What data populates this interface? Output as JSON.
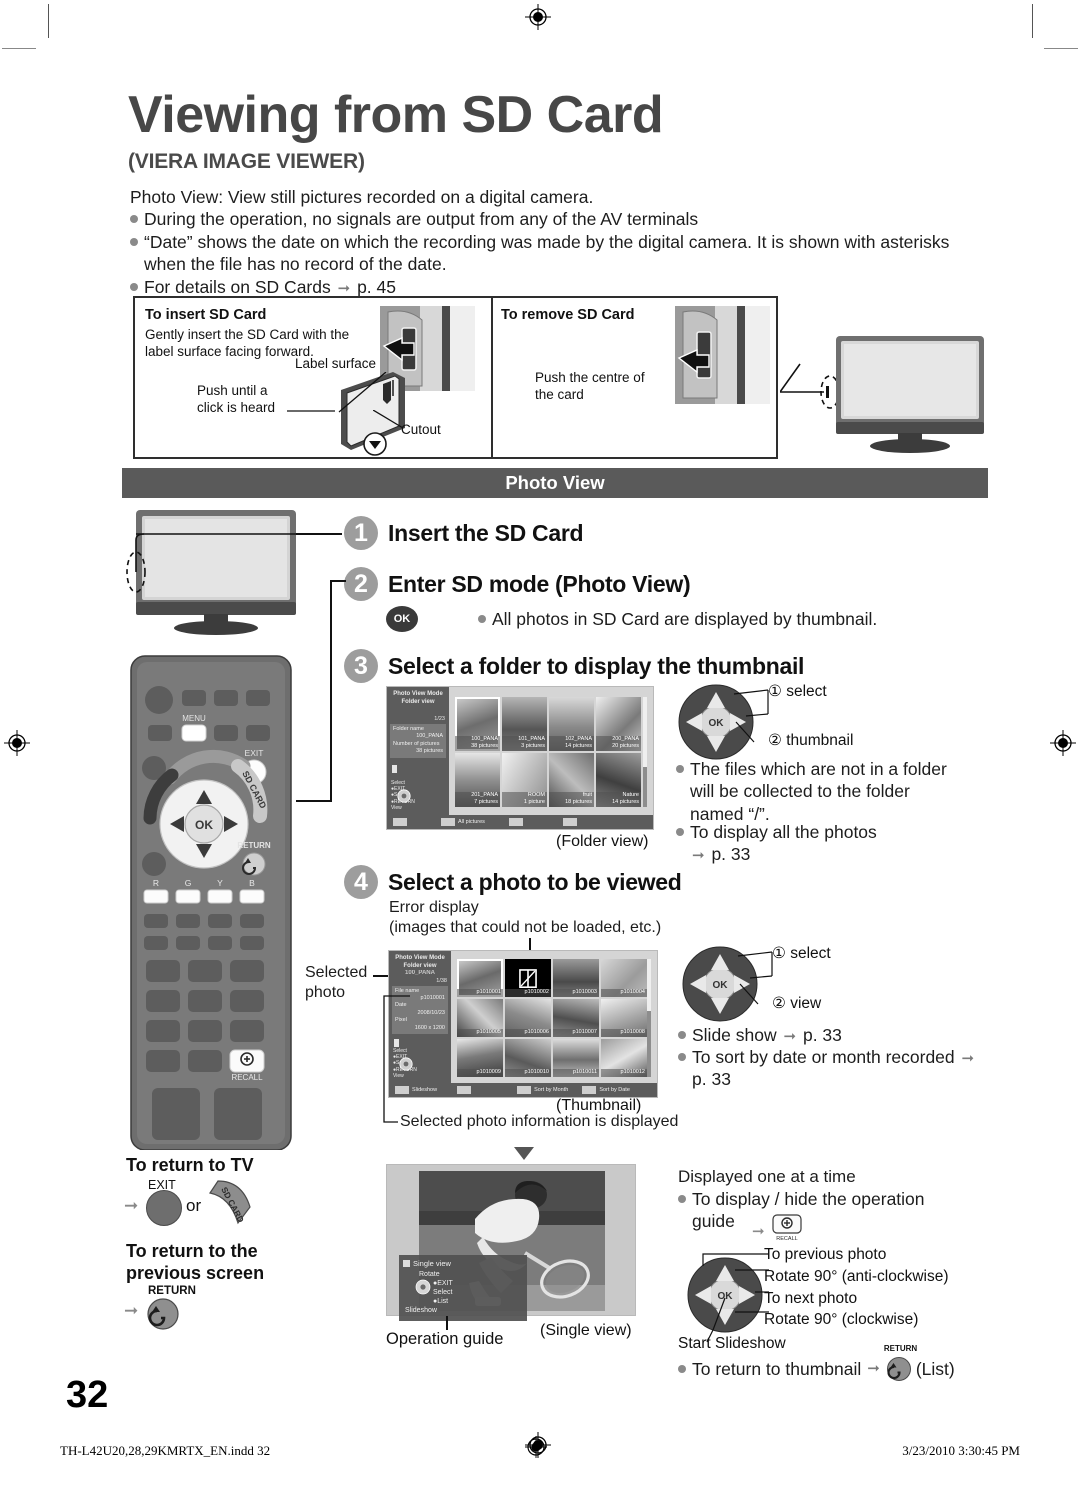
{
  "page": {
    "title": "Viewing from SD Card",
    "subtitle": "(VIERA IMAGE VIEWER)",
    "number": "32"
  },
  "intro": {
    "lead": "Photo View: View still pictures recorded on a digital camera.",
    "bullets": [
      "During the operation, no signals are output from any of the AV terminals",
      "“Date” shows the date on which the recording was made by the digital camera. It is shown with asterisks when the file has no record of the date.",
      "For details on SD Cards"
    ],
    "bullet3_ref": "p. 45"
  },
  "card_panel": {
    "insert": {
      "heading": "To insert SD Card",
      "text": "Gently insert the SD Card with the label surface facing forward.",
      "label_surface": "Label surface",
      "push_until": "Push until a\nclick is heard",
      "cutout": "Cutout"
    },
    "remove": {
      "heading": "To remove SD Card",
      "text": "Push the centre of\nthe card"
    }
  },
  "photo_view": {
    "bar_label": "Photo View",
    "steps": [
      {
        "num": "1",
        "title": "Insert the SD Card"
      },
      {
        "num": "2",
        "title": "Enter SD mode (Photo View)"
      },
      {
        "num": "3",
        "title": "Select a folder to display the thumbnail"
      },
      {
        "num": "4",
        "title": "Select a photo to be viewed"
      }
    ],
    "step2_note": "All photos in SD Card are displayed by thumbnail.",
    "step2_button": "OK"
  },
  "step3": {
    "dpad_1": "① select",
    "dpad_2": "② thumbnail",
    "bullets": [
      "The files which are not in a folder will be collected to the folder named “/”.",
      "To display all the photos"
    ],
    "ref": "p. 33",
    "screen_caption": "(Folder view)",
    "osd": {
      "mode_line1": "Photo View Mode",
      "mode_line2": "Folder view",
      "count": "1/23",
      "info_labels": [
        "Folder name",
        "Number of pictures"
      ],
      "info_values": [
        "100_PANA",
        "38 pictures"
      ],
      "guide": "Select\n●EXIT\n●Select\n●RETURN\nView",
      "bottom_label": "All pictures",
      "folders": [
        {
          "name": "100_PANA",
          "count": "38 pictures"
        },
        {
          "name": "101_PANA",
          "count": "3 pictures"
        },
        {
          "name": "102_PANA",
          "count": "14 pictures"
        },
        {
          "name": "200_PANA",
          "count": "20 pictures"
        },
        {
          "name": "201_PANA",
          "count": "7 pictures"
        },
        {
          "name": "ROOM",
          "count": "1 picture"
        },
        {
          "name": "fruit",
          "count": "18 pictures"
        },
        {
          "name": "Nature",
          "count": "14 pictures"
        }
      ]
    }
  },
  "step4": {
    "error_label": "Error display\n(images that could not be loaded, etc.)",
    "selected_photo_label": "Selected\nphoto",
    "info_note": "Selected photo information is displayed",
    "screen_caption": "(Thumbnail)",
    "dpad_1": "① select",
    "dpad_2": "② view",
    "bullets": [
      "Slide show",
      "To sort by date or month recorded"
    ],
    "refs": [
      "p. 33",
      "p. 33"
    ],
    "osd": {
      "mode_line1": "Photo View Mode",
      "mode_line2": "Folder view",
      "folder": "100_PANA",
      "count": "1/38",
      "info_labels": [
        "File name",
        "Date",
        "Pixel"
      ],
      "info_values": [
        "p1010001",
        "2008/10/23",
        "1600 x 1200"
      ],
      "guide": "Select\n●EXIT\n●Select\n●RETURN\nView",
      "bottom_items": [
        "Slideshow",
        "",
        "Sort by Month",
        "Sort by Date"
      ],
      "thumbs": [
        "p1010001",
        "p1010002",
        "p1010003",
        "p1010004",
        "p1010005",
        "p1010006",
        "p1010007",
        "p1010008",
        "p1010009",
        "p1010010",
        "p1010011",
        "p1010012"
      ]
    }
  },
  "return_block": {
    "to_tv_heading": "To return to TV",
    "exit_label": "EXIT",
    "or_label": "or",
    "sd_card_label": "SD CARD",
    "prev_heading": "To return to the previous screen",
    "return_label": "RETURN"
  },
  "single_view": {
    "caption": "(Single view)",
    "operation_guide_label": "Operation guide",
    "osd_title": "Single view",
    "osd_rotate": "Rotate",
    "osd_exit": "●EXIT",
    "osd_select": "Select",
    "osd_list": "●List",
    "osd_slideshow": "Slideshow"
  },
  "single_view_notes": {
    "heading": "Displayed one at a time",
    "bullet1": "To display / hide the operation guide",
    "recall_label": "RECALL",
    "dpad_labels": {
      "up": "To previous photo",
      "right_top": "Rotate 90° (anti-clockwise)",
      "right": "To next photo",
      "down": "Rotate 90° (clockwise)",
      "center": "Start Slideshow"
    },
    "bullet2": "To return to thumbnail",
    "return_label": "RETURN",
    "list_label": "(List)"
  },
  "remote": {
    "menu_label": "MENU",
    "exit_label": "EXIT",
    "sd_card_label": "SD CARD",
    "return_label": "RETURN",
    "recall_label": "RECALL",
    "ok_label": "OK",
    "color_keys": [
      "R",
      "G",
      "Y",
      "B"
    ]
  },
  "footer": {
    "left": "TH-L42U20,28,29KMRTX_EN.indd   32",
    "right": "3/23/2010   3:30:45 PM"
  }
}
